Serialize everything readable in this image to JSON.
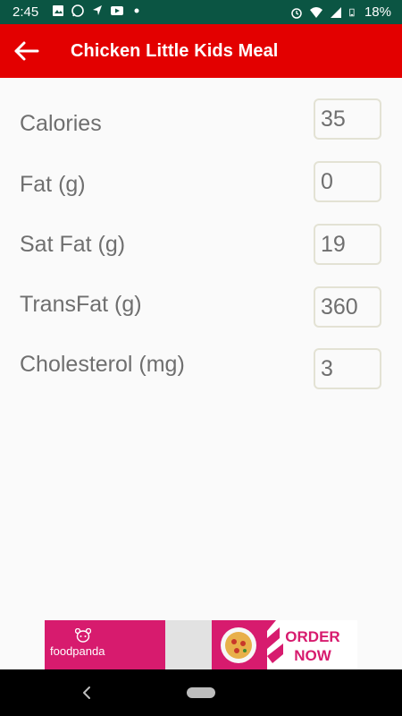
{
  "status_bar": {
    "time": "2:45",
    "battery": "18%",
    "icons": [
      "image-icon",
      "whatsapp-icon",
      "navigation-icon",
      "youtube-icon",
      "dot-icon",
      "alarm-icon",
      "wifi-icon",
      "signal-icon",
      "battery-icon"
    ]
  },
  "app_bar": {
    "title": "Chicken Little Kids Meal",
    "back_icon": "back-arrow-icon",
    "color": "#e30000"
  },
  "nutrition": [
    {
      "label": "Calories",
      "value": "35"
    },
    {
      "label": "Fat (g)",
      "value": "0"
    },
    {
      "label": "Sat Fat (g)",
      "value": "19"
    },
    {
      "label": "TransFat (g)",
      "value": "360"
    },
    {
      "label": "Cholesterol (mg)",
      "value": "3"
    }
  ],
  "ad": {
    "brand": "foodpanda",
    "cta_line1": "ORDER",
    "cta_line2": "NOW",
    "accent": "#d71b6e"
  },
  "nav_bar": {
    "icons": [
      "nav-back-icon",
      "home-pill-icon"
    ]
  }
}
